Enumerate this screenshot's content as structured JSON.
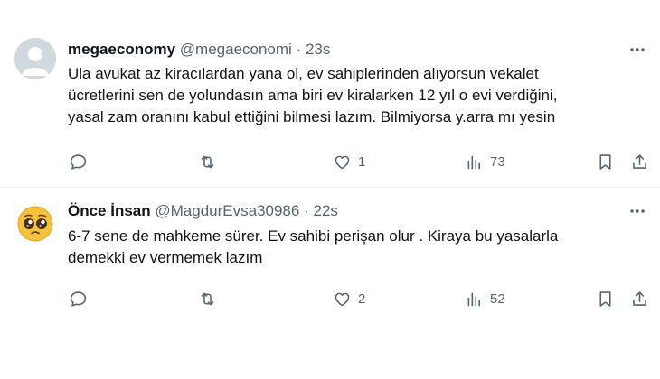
{
  "colors": {
    "text": "#0f1419",
    "muted": "#536471",
    "divider": "#eff3f4",
    "avatar_bg": "#cfd9de"
  },
  "tweets": [
    {
      "name": "megaeconomy",
      "handle": "@megaeconomi",
      "dot": "·",
      "time": "23s",
      "avatar_icon": "default-person-icon",
      "lines": [
        "Ula avukat az kiracılardan yana ol, ev sahiplerinden alıyorsun vekalet",
        "ücretlerini sen de yolundasın ama biri ev kiralarken 12 yıl o evi verdiğini,",
        "yasal zam oranını kabul ettiğini bilmesi lazım. Bilmiyorsa y.arra mı yesin"
      ],
      "replies": "",
      "retweets": "",
      "likes": "1",
      "views": "73"
    },
    {
      "name": "Önce İnsan",
      "handle": "@MagdurEvsa30986",
      "dot": "·",
      "time": "22s",
      "avatar_icon": "pleading-face-emoji-icon",
      "lines": [
        "6-7 sene de mahkeme sürer. Ev sahibi perişan olur . Kiraya bu yasalarla",
        "demekki ev vermemek lazım"
      ],
      "replies": "",
      "retweets": "",
      "likes": "2",
      "views": "52"
    }
  ]
}
